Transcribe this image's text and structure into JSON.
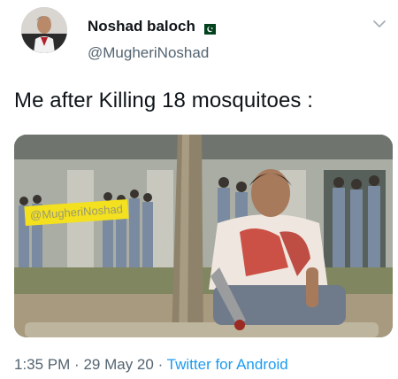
{
  "tweet": {
    "display_name": "Noshad baloch",
    "flag": "pakistan-flag",
    "handle": "@MugheriNoshad",
    "text": "Me after Killing 18 mosquitoes :",
    "time": "1:35 PM",
    "date": "29 May 20",
    "separator": "·",
    "source": "Twitter for Android"
  },
  "media": {
    "watermark": "@MugheriNoshad"
  },
  "colors": {
    "handle_gray": "#536471",
    "link_blue": "#1d9bf0",
    "watermark_yellow": "#f3e01f"
  },
  "icons": {
    "menu": "chevron-down-icon"
  }
}
